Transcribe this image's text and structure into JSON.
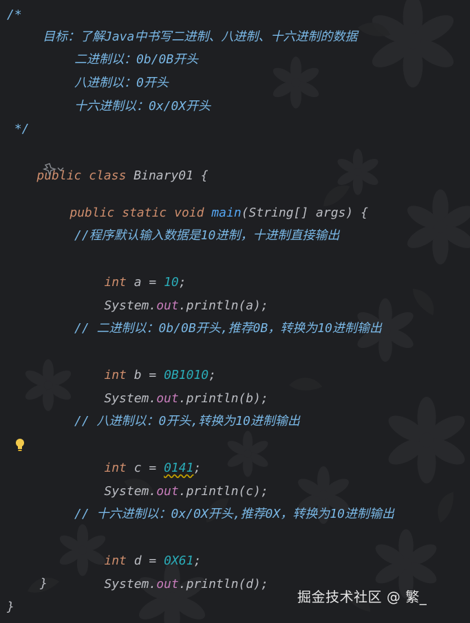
{
  "editor": {
    "background": "#1e1f22",
    "colors": {
      "keyword": "#cf8e6d",
      "method": "#56a8f5",
      "number": "#2aacb8",
      "comment": "#7ab8e6",
      "field": "#c77dbb",
      "text": "#bcbec4"
    },
    "lines": {
      "l1": "/*",
      "l2": "目标：了解Java中书写二进制、八进制、十六进制的数据",
      "l3": "二进制以：0b/0B开头",
      "l4": "八进制以：0开头",
      "l5": "十六进制以：0x/0X开头",
      "l6": " */",
      "class_kw1": "public",
      "class_kw2": "class",
      "class_name": "Binary01 {",
      "main_kw1": "public",
      "main_kw2": "static",
      "main_kw3": "void",
      "main_name": "main",
      "main_params": "(String[] args) {",
      "c1": "//程序默认输入数据是10进制，十进制直接输出",
      "int_kw": "int",
      "a_decl": "a = ",
      "a_val": "10",
      "semi": ";",
      "sys": "System.",
      "out": "out",
      "println_a": ".println(a);",
      "c2": "// 二进制以：0b/0B开头,推荐0B，转换为10进制输出",
      "b_decl": "b = ",
      "b_val": "0B1010",
      "println_b": ".println(b);",
      "c3": "// 八进制以：0开头,转换为10进制输出",
      "c_decl": "c = ",
      "c_val": "0141",
      "println_c": ".println(c);",
      "c4": "// 十六进制以：0x/0X开头,推荐0X，转换为10进制输出",
      "d_decl": "d = ",
      "d_val": "0X61",
      "println_d": ".println(d);",
      "close_method": "}",
      "close_class": "}"
    },
    "icons": {
      "gutter": "lightbulb-icon",
      "hint": "inlay-hint-icon"
    }
  },
  "watermark": "掘金技术社区 @ 繁_"
}
